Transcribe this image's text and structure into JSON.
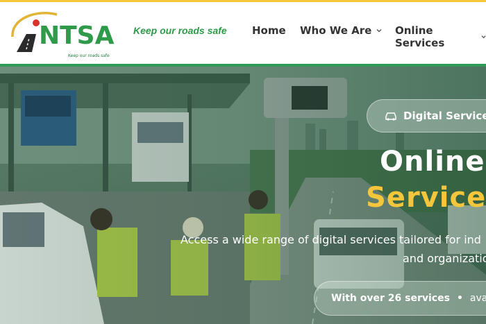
{
  "header": {
    "logo_text": "NTSA",
    "logo_subtagline": "Keep our roads safe",
    "tagline": "Keep our roads safe",
    "nav": [
      {
        "label": "Home",
        "has_dropdown": false
      },
      {
        "label": "Who We Are",
        "has_dropdown": true
      },
      {
        "label": "Online Services",
        "has_dropdown": true
      }
    ]
  },
  "hero": {
    "badge_label": "Digital Services",
    "badge_icon": "car-icon",
    "title_line1": "Online",
    "title_line2": "Service",
    "description_line1": "Access a wide range of digital services tailored for ind",
    "description_line2": "and organizations",
    "services_pill": {
      "count_text": "With over 26 services",
      "separator": "•",
      "trailing_text": "availa"
    }
  },
  "colors": {
    "brand_green": "#2f9a58",
    "accent_yellow": "#f5c63c",
    "nav_text": "#333333"
  }
}
